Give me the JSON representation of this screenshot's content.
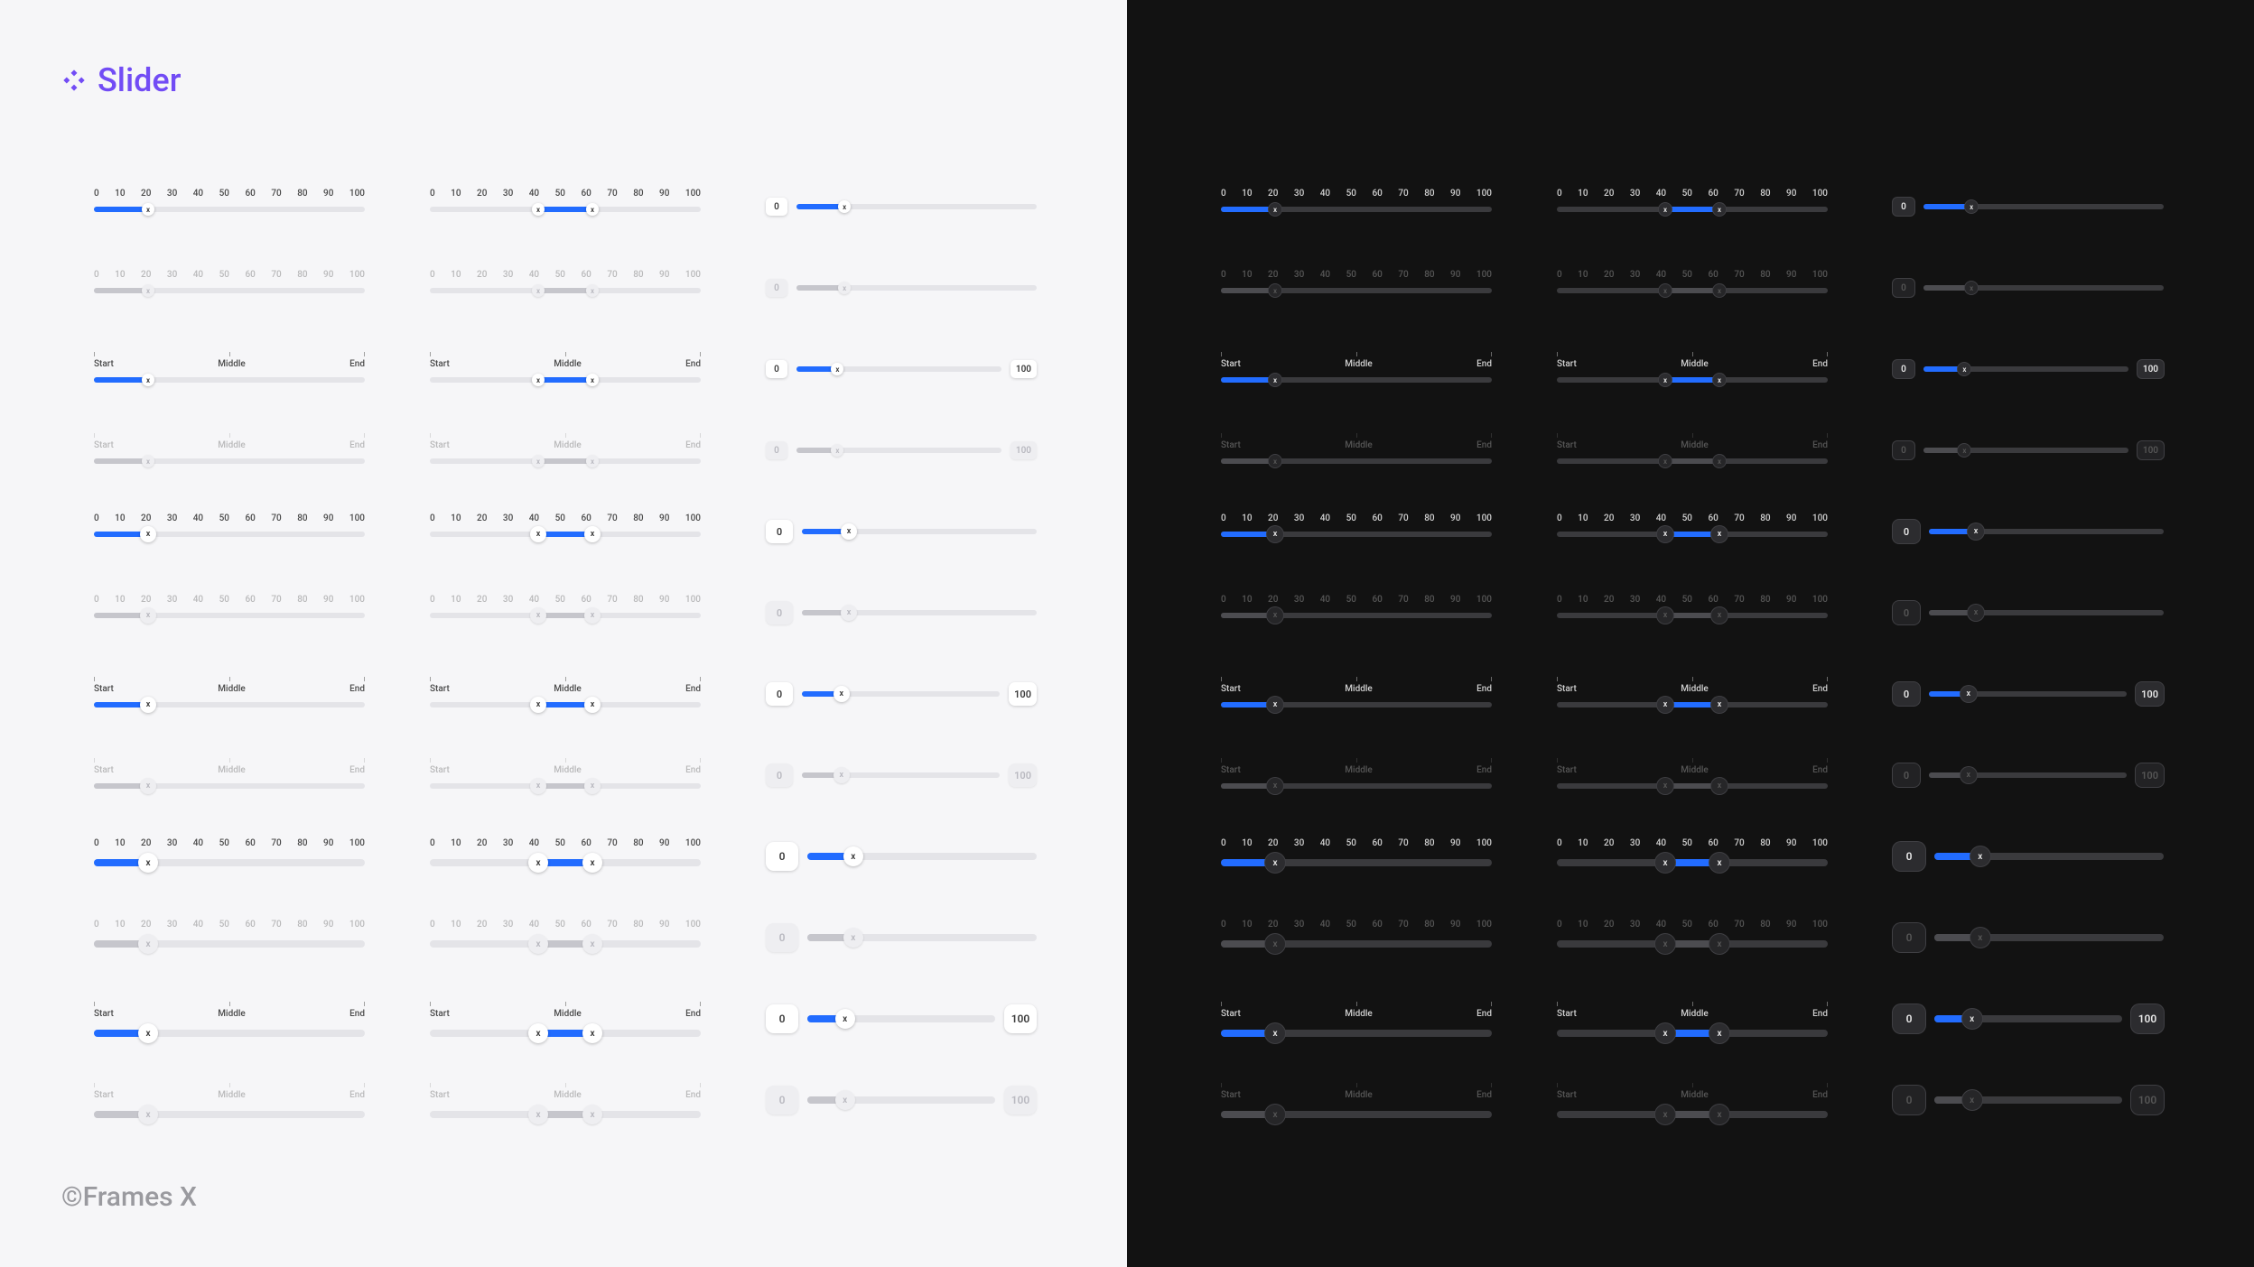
{
  "component": {
    "name": "Slider"
  },
  "footer": {
    "label": "©Frames X"
  },
  "scale": {
    "values": [
      "0",
      "10",
      "20",
      "30",
      "40",
      "50",
      "60",
      "70",
      "80",
      "90",
      "100"
    ]
  },
  "labels": {
    "start": "Start",
    "middle": "Middle",
    "end": "End"
  },
  "boxvals": {
    "zero": "0",
    "hundred": "100"
  },
  "thumbvals": {
    "a": "x",
    "b": "x"
  },
  "chart_data": {
    "type": "table",
    "title": "Slider component states",
    "scale_ticks": [
      0,
      10,
      20,
      30,
      40,
      50,
      60,
      70,
      80,
      90,
      100
    ],
    "text_labels": [
      "Start",
      "Middle",
      "End"
    ],
    "columns": [
      "single-value",
      "range",
      "with-value-boxes"
    ],
    "sizes": [
      "sm",
      "md",
      "lg"
    ],
    "value_single_pct": 20,
    "value_range_pct": [
      40,
      60
    ],
    "valuebox_left": 0,
    "valuebox_right": 100,
    "themes": [
      "light",
      "dark"
    ],
    "rows": [
      {
        "id": "sm-ticks-enabled",
        "size": "sm",
        "scale": "numeric",
        "state": "enabled"
      },
      {
        "id": "sm-ticks-disabled",
        "size": "sm",
        "scale": "numeric",
        "state": "disabled"
      },
      {
        "id": "sm-labels-enabled",
        "size": "sm",
        "scale": "text",
        "state": "enabled"
      },
      {
        "id": "sm-labels-disabled",
        "size": "sm",
        "scale": "text",
        "state": "disabled"
      },
      {
        "id": "md-ticks-enabled",
        "size": "md",
        "scale": "numeric",
        "state": "enabled"
      },
      {
        "id": "md-ticks-disabled",
        "size": "md",
        "scale": "numeric",
        "state": "disabled"
      },
      {
        "id": "md-labels-enabled",
        "size": "md",
        "scale": "text",
        "state": "enabled"
      },
      {
        "id": "md-labels-disabled",
        "size": "md",
        "scale": "text",
        "state": "disabled"
      },
      {
        "id": "lg-ticks-enabled",
        "size": "lg",
        "scale": "numeric",
        "state": "enabled"
      },
      {
        "id": "lg-ticks-disabled",
        "size": "lg",
        "scale": "numeric",
        "state": "disabled"
      },
      {
        "id": "lg-labels-enabled",
        "size": "lg",
        "scale": "text",
        "state": "enabled"
      },
      {
        "id": "lg-labels-disabled",
        "size": "lg",
        "scale": "text",
        "state": "disabled"
      }
    ]
  }
}
